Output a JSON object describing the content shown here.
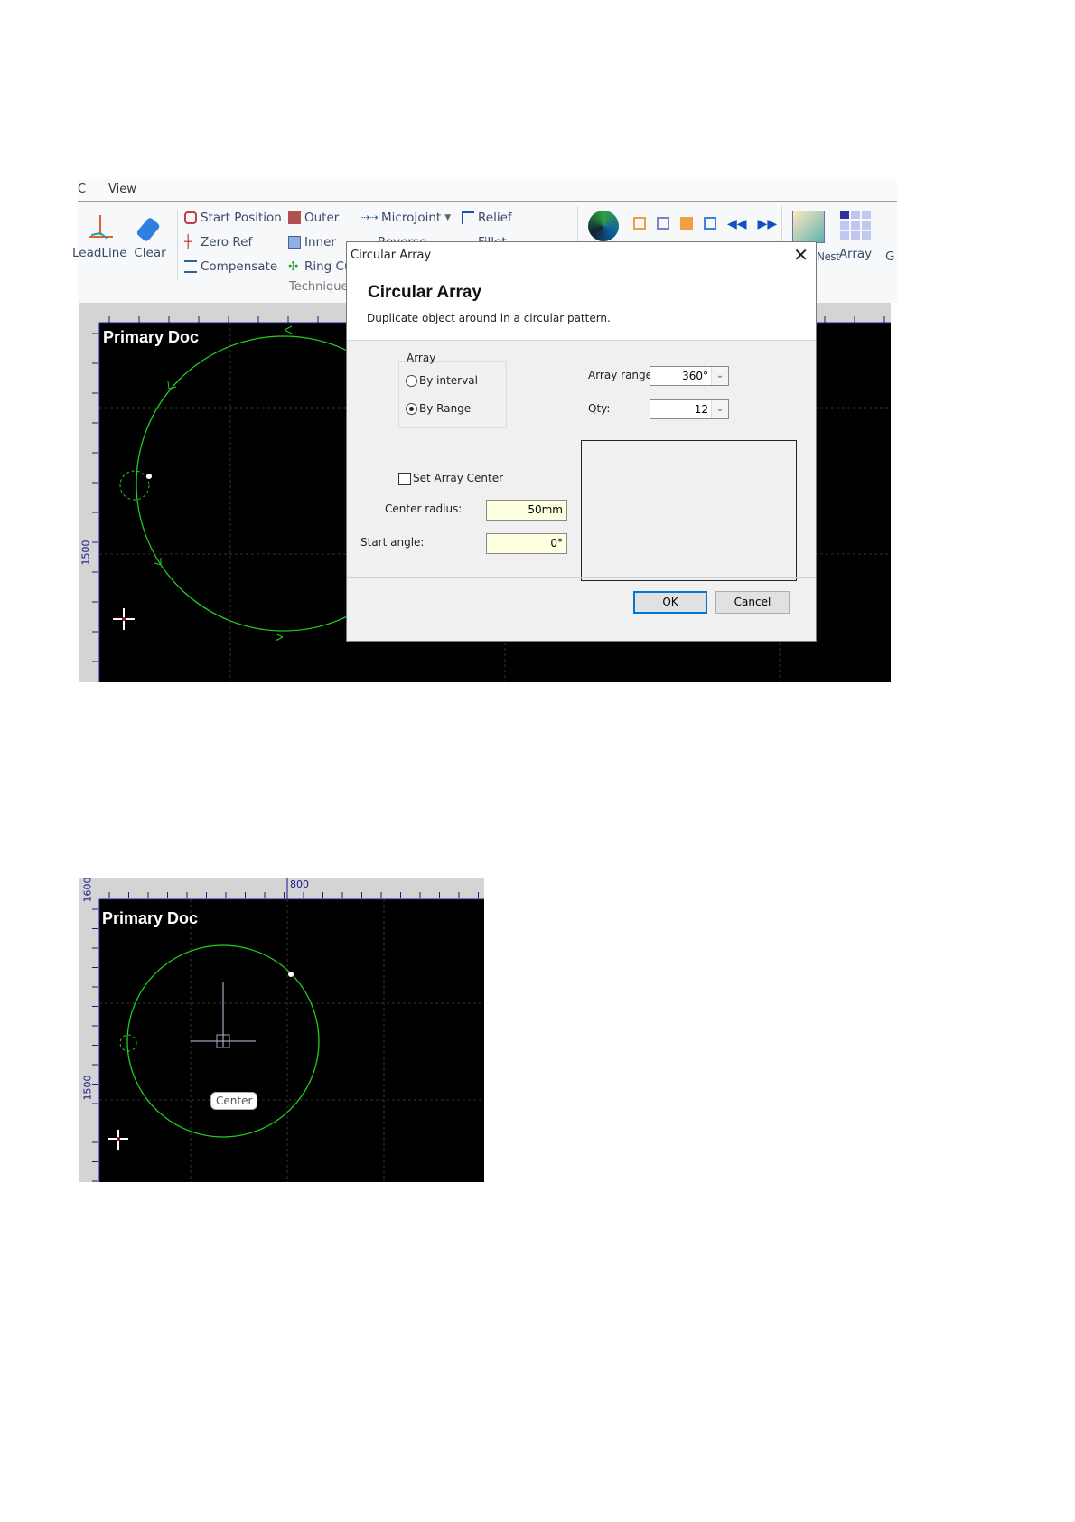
{
  "ribbon": {
    "tabs": [
      "C",
      "View"
    ],
    "big_buttons": [
      {
        "label": "LeadLine",
        "icon": "leadline-icon"
      },
      {
        "label": "Clear",
        "icon": "eraser-icon"
      }
    ],
    "col1": [
      {
        "label": "Start Position",
        "icon": "start-position-icon"
      },
      {
        "label": "Zero Ref",
        "icon": "zero-ref-icon"
      },
      {
        "label": "Compensate",
        "icon": "compensate-icon"
      }
    ],
    "col2": [
      {
        "label": "Outer",
        "icon": "outer-icon"
      },
      {
        "label": "Inner",
        "icon": "inner-icon"
      },
      {
        "label": "Ring Cut",
        "icon": "ring-cut-icon"
      }
    ],
    "col3": [
      {
        "label": "MicroJoint",
        "icon": "microjoint-icon"
      },
      {
        "label": "Reverse",
        "icon": "reverse-icon"
      }
    ],
    "col4": [
      {
        "label": "Relief",
        "icon": "relief-icon"
      },
      {
        "label": "Fillet",
        "icon": "fillet-icon"
      }
    ],
    "group_label": "Technique",
    "right_buttons": [
      {
        "label": "Nest",
        "icon": "nest-icon"
      },
      {
        "label": "Array",
        "icon": "array-icon"
      },
      {
        "label": "G",
        "icon": "group-icon"
      }
    ]
  },
  "canvas_top": {
    "doc_label": "Primary Doc",
    "ruler_v_label": "1500"
  },
  "dialog": {
    "window_title": "Circular Array",
    "heading": "Circular Array",
    "description": "Duplicate object around in a circular pattern.",
    "group_label": "Array",
    "radio_interval": "By interval",
    "radio_range": "By Range",
    "selected_mode": "By Range",
    "array_range_label": "Array range",
    "array_range_value": "360°",
    "qty_label": "Qty:",
    "qty_value": "12",
    "set_center_label": "Set Array Center",
    "set_center_checked": false,
    "center_radius_label": "Center radius:",
    "center_radius_value": "50mm",
    "start_angle_label": "Start angle:",
    "start_angle_value": "0°",
    "ok": "OK",
    "cancel": "Cancel"
  },
  "canvas_bottom": {
    "doc_label": "Primary Doc",
    "ruler_h_label": "800",
    "ruler_v_top": "1600",
    "ruler_v_label": "1500",
    "callout": "Center"
  },
  "colors": {
    "path": "#22cc22",
    "canvas": "#000000",
    "accent": "#0078d7",
    "ruler": "#1a1a8a"
  }
}
